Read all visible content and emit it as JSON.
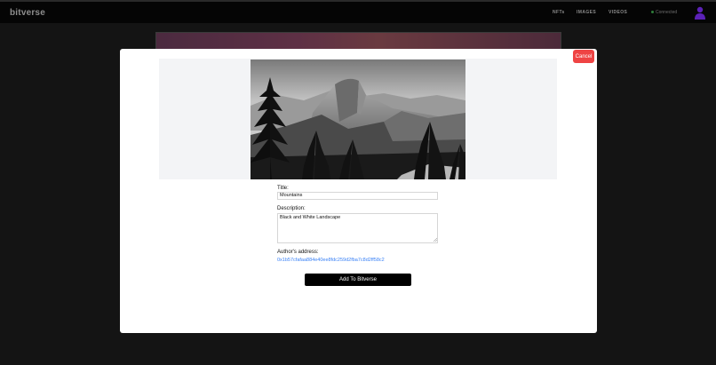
{
  "app": {
    "logo": "bitverse"
  },
  "nav": {
    "nfts": "NFTs",
    "images": "IMAGES",
    "videos": "VIDEOS",
    "connection_status": "Connected"
  },
  "modal": {
    "cancel_label": "Cancel",
    "title_label": "Title:",
    "title_value": "Mountains",
    "description_label": "Description:",
    "description_value": "Black and White Landscape",
    "author_label": "Author's address:",
    "author_address": "0x1b57cfafaa884e40ee8fdc259d2fba7c8d2ff58c2",
    "submit_label": "Add To Bitverse",
    "image_description": "mountain-landscape-photo",
    "colors": {
      "cancel": "#ef4444",
      "submit": "#000000",
      "link": "#3b82f6"
    }
  }
}
